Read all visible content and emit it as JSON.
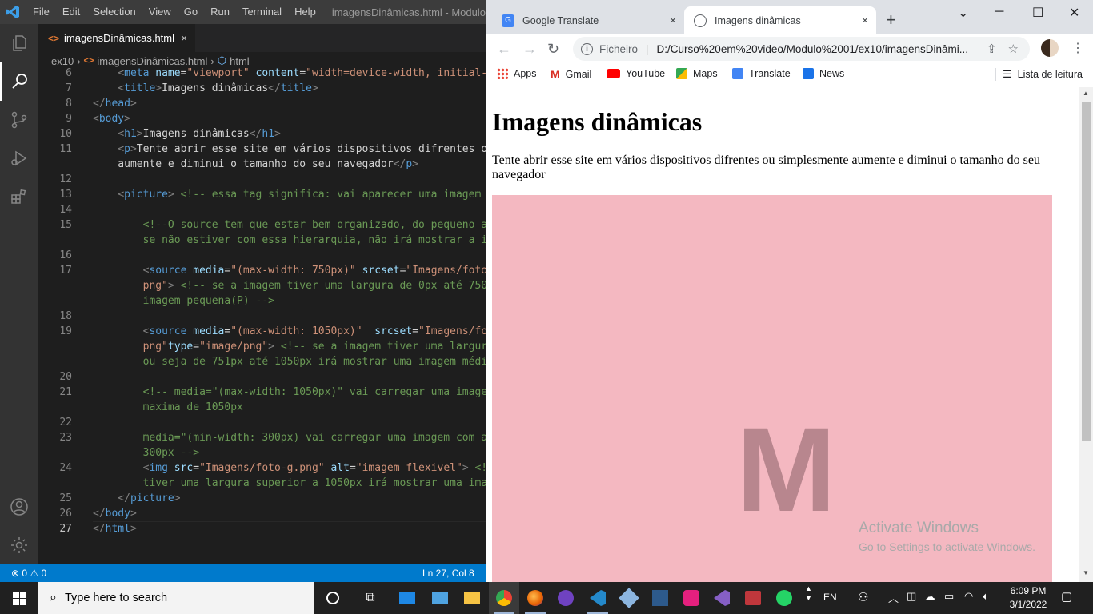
{
  "vscode": {
    "menu": [
      "File",
      "Edit",
      "Selection",
      "View",
      "Go",
      "Run",
      "Terminal",
      "Help"
    ],
    "window_title": "imagensDinâmicas.html - Modulo",
    "tab_label": "imagensDinâmicas.html",
    "tab_close": "×",
    "breadcrumb": {
      "folder": "ex10",
      "file": "imagensDinâmicas.html",
      "symbol": "html"
    },
    "line_numbers": [
      "6",
      "7",
      "8",
      "9",
      "10",
      "11",
      "",
      "12",
      "13",
      "14",
      "15",
      "",
      "16",
      "17",
      "",
      "",
      "18",
      "19",
      "",
      "",
      "20",
      "21",
      "",
      "22",
      "23",
      "",
      "24",
      "",
      "25",
      "26",
      "27"
    ],
    "status_problems": "⊗ 0 ⚠ 0",
    "status_position": "Ln 27, Col 8"
  },
  "chrome": {
    "tabs": [
      {
        "label": "Google Translate",
        "close": "×"
      },
      {
        "label": "Imagens dinâmicas",
        "close": "×"
      }
    ],
    "new_tab": "+",
    "address_scheme": "Ficheiro",
    "address_url": "D:/Curso%20em%20video/Modulo%2001/ex10/imagensDinâmi...",
    "bookmarks": [
      {
        "label": "Apps",
        "color": "#4285f4"
      },
      {
        "label": "Gmail",
        "color": "#d93025"
      },
      {
        "label": "YouTube",
        "color": "#ff0000"
      },
      {
        "label": "Maps",
        "color": "#34a853"
      },
      {
        "label": "Translate",
        "color": "#4285f4"
      },
      {
        "label": "News",
        "color": "#1a73e8"
      }
    ],
    "reading_list": "Lista de leitura"
  },
  "page": {
    "heading": "Imagens dinâmicas",
    "paragraph": "Tente abrir esse site em vários dispositivos difrentes ou simplesmente aumente e diminui o tamanho do seu navegador",
    "image_letter": "M",
    "image_color": "#f4b8c1"
  },
  "watermark": {
    "title": "Activate Windows",
    "subtitle": "Go to Settings to activate Windows."
  },
  "taskbar": {
    "search_placeholder": "Type here to search",
    "language": "EN",
    "time": "6:09 PM",
    "date": "3/1/2022"
  }
}
